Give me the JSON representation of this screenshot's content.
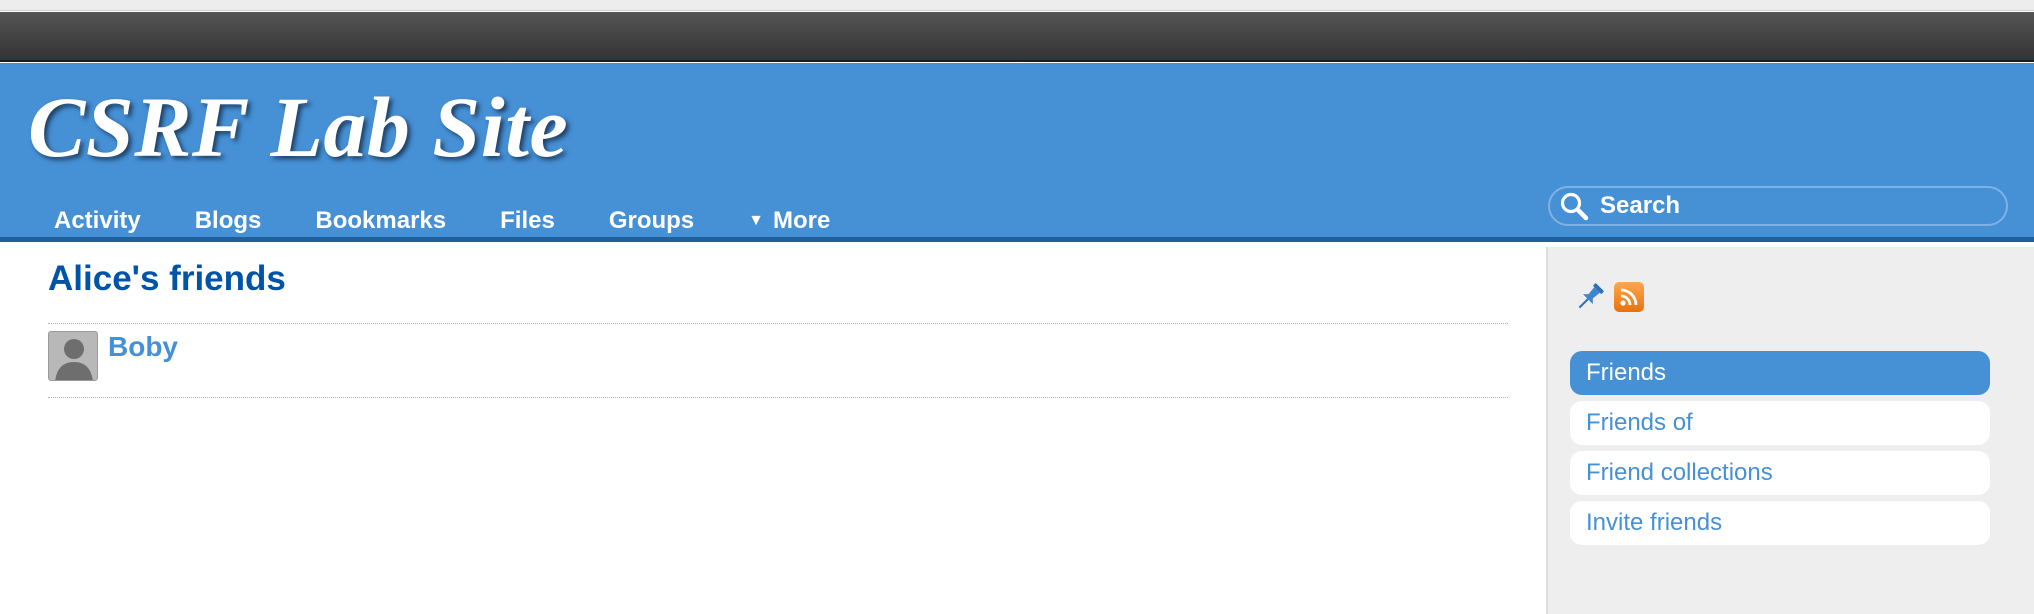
{
  "site": {
    "title": "CSRF Lab Site"
  },
  "nav": {
    "items": [
      {
        "label": "Activity"
      },
      {
        "label": "Blogs"
      },
      {
        "label": "Bookmarks"
      },
      {
        "label": "Files"
      },
      {
        "label": "Groups"
      }
    ],
    "more": {
      "label": "More",
      "icon": "caret-down-icon",
      "caret": "▼"
    }
  },
  "search": {
    "placeholder": "Search",
    "icon": "search-icon"
  },
  "main": {
    "title": "Alice's friends",
    "friends": [
      {
        "name": "Boby",
        "avatar": "default-avatar"
      }
    ]
  },
  "sidebar": {
    "icons": [
      "pin-icon",
      "rss-icon"
    ],
    "menu": [
      {
        "label": "Friends",
        "selected": true
      },
      {
        "label": "Friends of",
        "selected": false
      },
      {
        "label": "Friend collections",
        "selected": false
      },
      {
        "label": "Invite friends",
        "selected": false
      }
    ]
  },
  "colors": {
    "header": "#4690d6",
    "header_border": "#1f5f9c",
    "topbar": "#333333",
    "title_text": "#0054a7",
    "link": "#4690d6",
    "sidebar_bg": "#eeeeee",
    "rss": "#f7931e"
  }
}
